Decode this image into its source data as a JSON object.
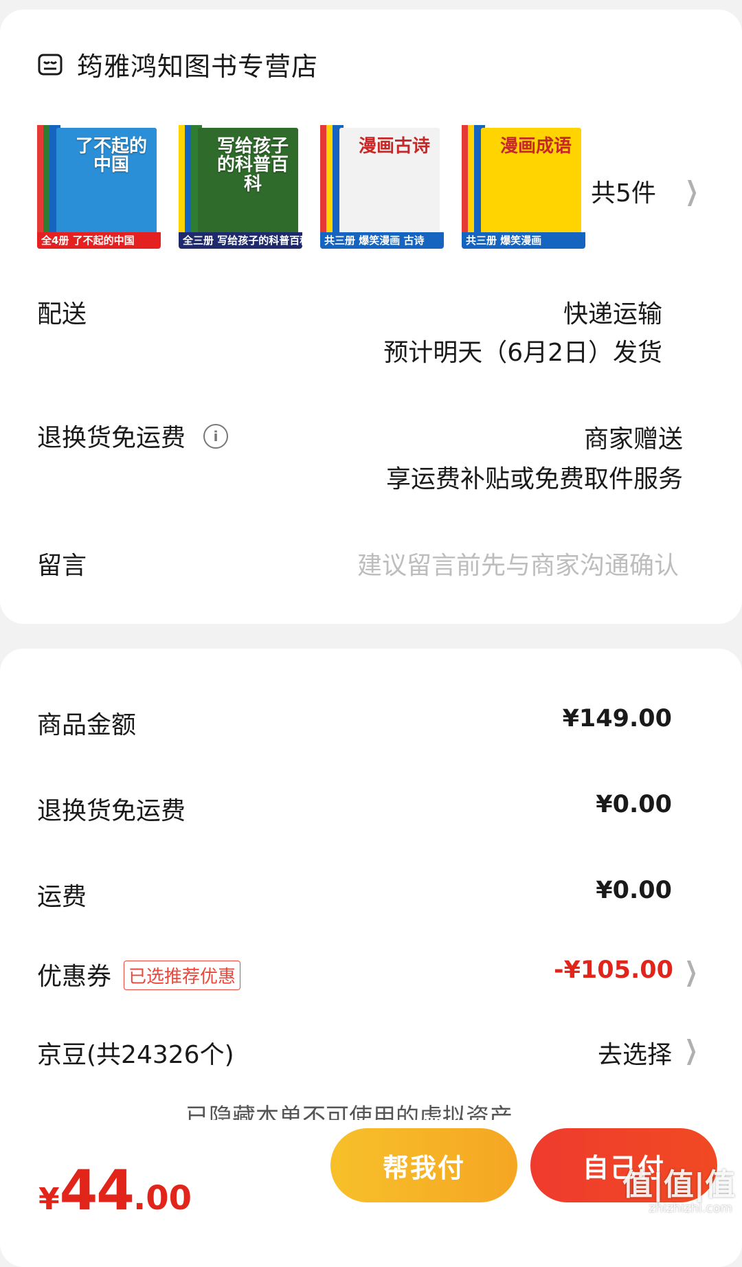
{
  "store": {
    "name": "筠雅鸿知图书专营店",
    "icon": "store-icon"
  },
  "books": [
    {
      "title": "了不起的中国",
      "band": "全4册 了不起的中国",
      "cover_color": "#2a8fd6",
      "band_color": "#e52020",
      "spines": [
        "#e53935",
        "#2e7d32",
        "#1565c0"
      ]
    },
    {
      "title": "写给孩子的科普百科",
      "band": "全三册 写给孩子的科普百科启蒙书",
      "cover_color": "#2f6b2a",
      "band_color": "#1e2a6b",
      "spines": [
        "#ffd400",
        "#1565c0",
        "#2e7d32"
      ]
    },
    {
      "title": "漫画古诗",
      "band": "共三册 爆笑漫画 古诗",
      "cover_color": "#f2f2f2",
      "band_color": "#1565c0",
      "spines": [
        "#e53935",
        "#ffd400",
        "#1565c0"
      ]
    },
    {
      "title": "漫画成语",
      "band": "共三册 爆笑漫画",
      "cover_color": "#ffd400",
      "band_color": "#1565c0",
      "spines": [
        "#e53935",
        "#ffd400",
        "#1565c0"
      ]
    }
  ],
  "items_count": "共5件",
  "delivery": {
    "label": "配送",
    "method": "快递运输",
    "eta": "预计明天（6月2日）发货"
  },
  "return_service": {
    "label": "退换货免运费",
    "provider": "商家赠送",
    "desc": "享运费补贴或免费取件服务"
  },
  "message": {
    "label": "留言",
    "placeholder": "建议留言前先与商家沟通确认"
  },
  "summary": {
    "goods_label": "商品金额",
    "goods_value": "¥149.00",
    "return_label": "退换货免运费",
    "return_value": "¥0.00",
    "shipping_label": "运费",
    "shipping_value": "¥0.00",
    "coupon_label": "优惠券",
    "coupon_tag": "已选推荐优惠",
    "coupon_value": "-¥105.00",
    "beans_label": "京豆(共24326个)",
    "beans_action": "去选择"
  },
  "hidden_note": "已隐藏本单不可使用的虚拟资产",
  "footer": {
    "total_yen": "¥",
    "total_int": "44",
    "total_dec": ".00",
    "help_pay": "帮我付",
    "self_pay": "自己付"
  },
  "watermark": {
    "main": "值|值|值",
    "sub": "zhizhizhi.com"
  },
  "colors": {
    "accent_red": "#e1251b",
    "help_btn": "#f5a623",
    "self_btn": "#ef3b2e"
  }
}
